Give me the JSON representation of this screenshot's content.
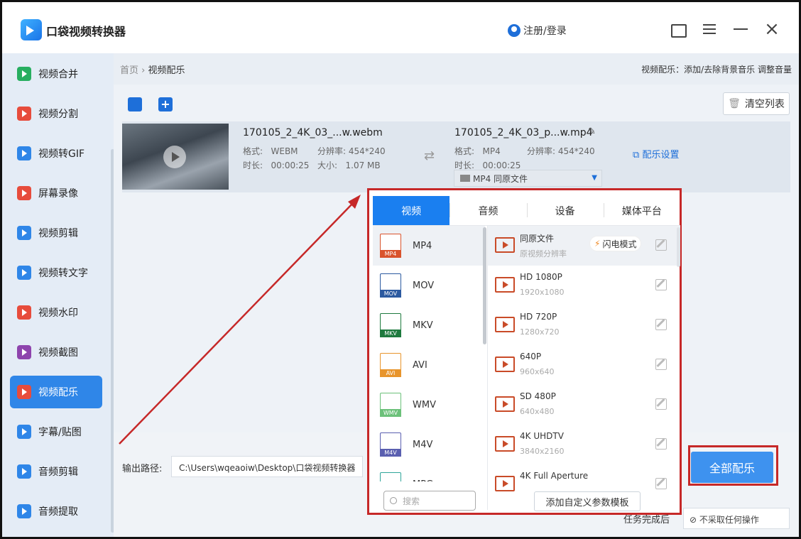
{
  "app": {
    "title": "口袋视频转换器",
    "login": "注册/登录"
  },
  "sidebar": {
    "items": [
      {
        "label": "视频合并",
        "color": "#27ae60"
      },
      {
        "label": "视频分割",
        "color": "#e74c3c"
      },
      {
        "label": "视频转GIF",
        "color": "#2f86e8"
      },
      {
        "label": "屏幕录像",
        "color": "#e74c3c"
      },
      {
        "label": "视频剪辑",
        "color": "#2f86e8"
      },
      {
        "label": "视频转文字",
        "color": "#2f86e8"
      },
      {
        "label": "视频水印",
        "color": "#e74c3c"
      },
      {
        "label": "视频截图",
        "color": "#8e44ad"
      },
      {
        "label": "视频配乐",
        "color": "#e74c3c"
      },
      {
        "label": "字幕/贴图",
        "color": "#2f86e8"
      },
      {
        "label": "音频剪辑",
        "color": "#2f86e8"
      },
      {
        "label": "音频提取",
        "color": "#2f86e8"
      }
    ],
    "active_index": 8
  },
  "breadcrumb": {
    "home": "首页",
    "sep": "›",
    "current": "视频配乐"
  },
  "hint": "视频配乐：添加/去除背景音乐 调整音量",
  "toolbar": {
    "clear_list": "清空列表"
  },
  "file": {
    "source_name": "170105_2_4K_03_...w.webm",
    "source_format_label": "格式:",
    "source_format": "WEBM",
    "source_res_label": "分辨率:",
    "source_res": "454*240",
    "source_dur_label": "时长:",
    "source_dur": "00:00:25",
    "source_size_label": "大小:",
    "source_size": "1.07 MB",
    "target_name": "170105_2_4K_03_p...w.mp4",
    "target_format_label": "格式:",
    "target_format": "MP4",
    "target_res_label": "分辨率:",
    "target_res": "454*240",
    "target_dur_label": "时长:",
    "target_dur": "00:00:25",
    "format_select": "MP4  同原文件",
    "settings": "配乐设置"
  },
  "popup": {
    "tabs": [
      "视频",
      "音频",
      "设备",
      "媒体平台"
    ],
    "active_tab": 0,
    "formats": [
      {
        "name": "MP4",
        "color": "#d9532c"
      },
      {
        "name": "MOV",
        "color": "#2c5aa0"
      },
      {
        "name": "MKV",
        "color": "#1e7a3e"
      },
      {
        "name": "AVI",
        "color": "#e8952c"
      },
      {
        "name": "WMV",
        "color": "#6cc17a"
      },
      {
        "name": "M4V",
        "color": "#5a5fb0"
      },
      {
        "name": "MPG",
        "color": "#2fa59a"
      }
    ],
    "presets": [
      {
        "name": "同原文件",
        "res": "原视频分辨率"
      },
      {
        "name": "HD 1080P",
        "res": "1920x1080"
      },
      {
        "name": "HD 720P",
        "res": "1280x720"
      },
      {
        "name": "640P",
        "res": "960x640"
      },
      {
        "name": "SD 480P",
        "res": "640x480"
      },
      {
        "name": "4K UHDTV",
        "res": "3840x2160"
      },
      {
        "name": "4K Full Aperture",
        "res": ""
      }
    ],
    "flash_mode": "闪电模式",
    "search_placeholder": "搜索",
    "custom_template": "添加自定义参数模板"
  },
  "output": {
    "label": "输出路径:",
    "path": "C:\\Users\\wqeaoiw\\Desktop\\口袋视频转换器",
    "after_label": "任务完成后",
    "after_value": "不采取任何操作"
  },
  "convert_all": "全部配乐",
  "accent": "#1a7ff0",
  "annotation_color": "#c62828"
}
